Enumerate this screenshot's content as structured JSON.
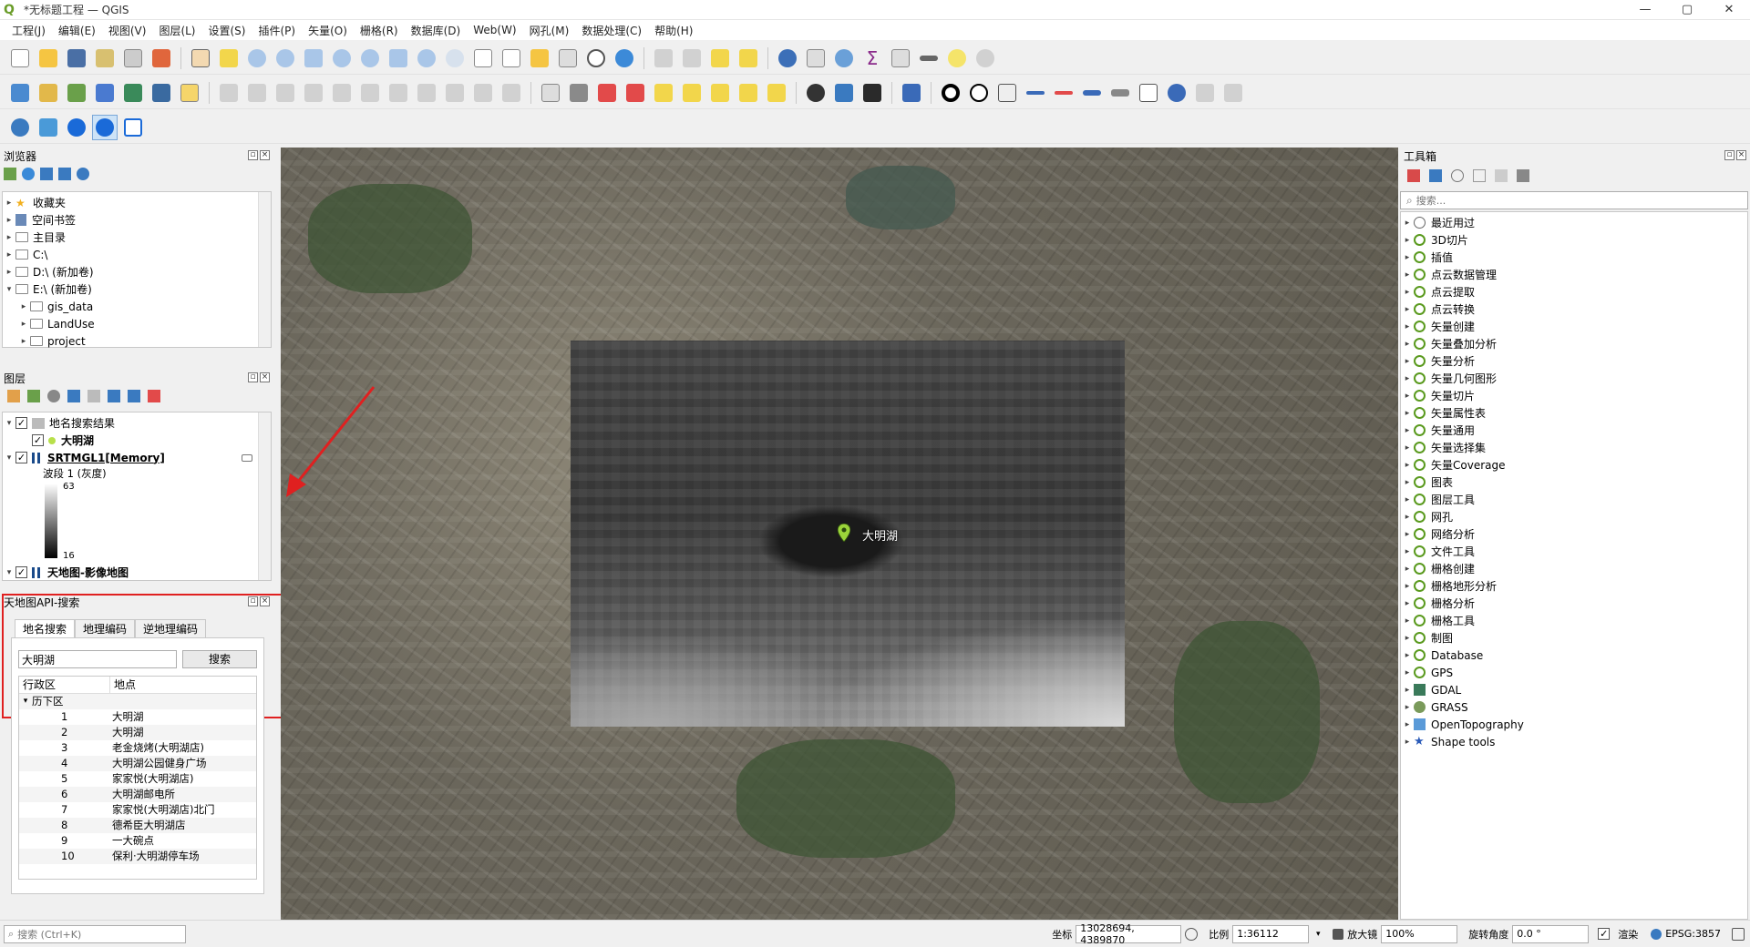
{
  "window": {
    "title": "*无标题工程 — QGIS",
    "app_icon": "Q",
    "min": "—",
    "max": "▢",
    "close": "✕"
  },
  "menu": [
    "工程(J)",
    "编辑(E)",
    "视图(V)",
    "图层(L)",
    "设置(S)",
    "插件(P)",
    "矢量(O)",
    "栅格(R)",
    "数据库(D)",
    "Web(W)",
    "网孔(M)",
    "数据处理(C)",
    "帮助(H)"
  ],
  "browser": {
    "title": "浏览器",
    "items": [
      {
        "label": "收藏夹",
        "icon": "star-icon",
        "indent": 0,
        "arrow": "▸"
      },
      {
        "label": "空间书签",
        "icon": "bookmark-icon",
        "indent": 0,
        "arrow": "▸"
      },
      {
        "label": "主目录",
        "icon": "folder-icon",
        "indent": 0,
        "arrow": "▸"
      },
      {
        "label": "C:\\",
        "icon": "folder-icon",
        "indent": 0,
        "arrow": "▸"
      },
      {
        "label": "D:\\ (新加卷)",
        "icon": "folder-icon",
        "indent": 0,
        "arrow": "▸"
      },
      {
        "label": "E:\\ (新加卷)",
        "icon": "folder-icon",
        "indent": 0,
        "arrow": "▾"
      },
      {
        "label": "gis_data",
        "icon": "folder-icon",
        "indent": 1,
        "arrow": "▸"
      },
      {
        "label": "LandUse",
        "icon": "folder-icon",
        "indent": 1,
        "arrow": "▸"
      },
      {
        "label": "project",
        "icon": "folder-icon",
        "indent": 1,
        "arrow": "▸"
      }
    ]
  },
  "layers": {
    "title": "图层",
    "items": [
      {
        "label": "地名搜索结果",
        "checked": true,
        "bold": false
      },
      {
        "label": "大明湖",
        "checked": true,
        "bold": true,
        "sub": true
      },
      {
        "label": "SRTMGL1[Memory]",
        "checked": true,
        "bold": true
      },
      {
        "label": "天地图-影像地图",
        "checked": true,
        "bold": true
      }
    ],
    "band_label": "波段 1 (灰度)",
    "legend_max": "63",
    "legend_min": "16"
  },
  "search_panel": {
    "title": "天地图API-搜索",
    "tabs": [
      "地名搜索",
      "地理编码",
      "逆地理编码"
    ],
    "query": "大明湖",
    "search_button": "搜索",
    "col_region": "行政区",
    "col_place": "地点",
    "group": "历下区",
    "results": [
      {
        "n": "1",
        "name": "大明湖"
      },
      {
        "n": "2",
        "name": "大明湖"
      },
      {
        "n": "3",
        "name": "老金烧烤(大明湖店)"
      },
      {
        "n": "4",
        "name": "大明湖公园健身广场"
      },
      {
        "n": "5",
        "name": "家家悦(大明湖店)"
      },
      {
        "n": "6",
        "name": "大明湖邮电所"
      },
      {
        "n": "7",
        "name": "家家悦(大明湖店)北门"
      },
      {
        "n": "8",
        "name": "德希臣大明湖店"
      },
      {
        "n": "9",
        "name": "一大碗点"
      },
      {
        "n": "10",
        "name": "保利·大明湖停车场"
      }
    ]
  },
  "map": {
    "marker_label": "大明湖"
  },
  "toolbox": {
    "title": "工具箱",
    "search_placeholder": "搜索...",
    "items": [
      "最近用过",
      "3D切片",
      "插值",
      "点云数据管理",
      "点云提取",
      "点云转换",
      "矢量创建",
      "矢量叠加分析",
      "矢量分析",
      "矢量几何图形",
      "矢量切片",
      "矢量属性表",
      "矢量通用",
      "矢量选择集",
      "矢量Coverage",
      "图表",
      "图层工具",
      "网孔",
      "网络分析",
      "文件工具",
      "栅格创建",
      "栅格地形分析",
      "栅格分析",
      "栅格工具",
      "制图",
      "Database",
      "GPS",
      "GDAL",
      "GRASS",
      "OpenTopography",
      "Shape tools"
    ]
  },
  "status": {
    "search_placeholder": "搜索 (Ctrl+K)",
    "coord_label": "坐标",
    "coord_value": "13028694, 4389870",
    "scale_label": "比例",
    "scale_value": "1:36112",
    "magnifier_label": "放大镜",
    "magnifier_value": "100%",
    "rotation_label": "旋转角度",
    "rotation_value": "0.0 °",
    "render_label": "渲染",
    "crs": "EPSG:3857"
  }
}
